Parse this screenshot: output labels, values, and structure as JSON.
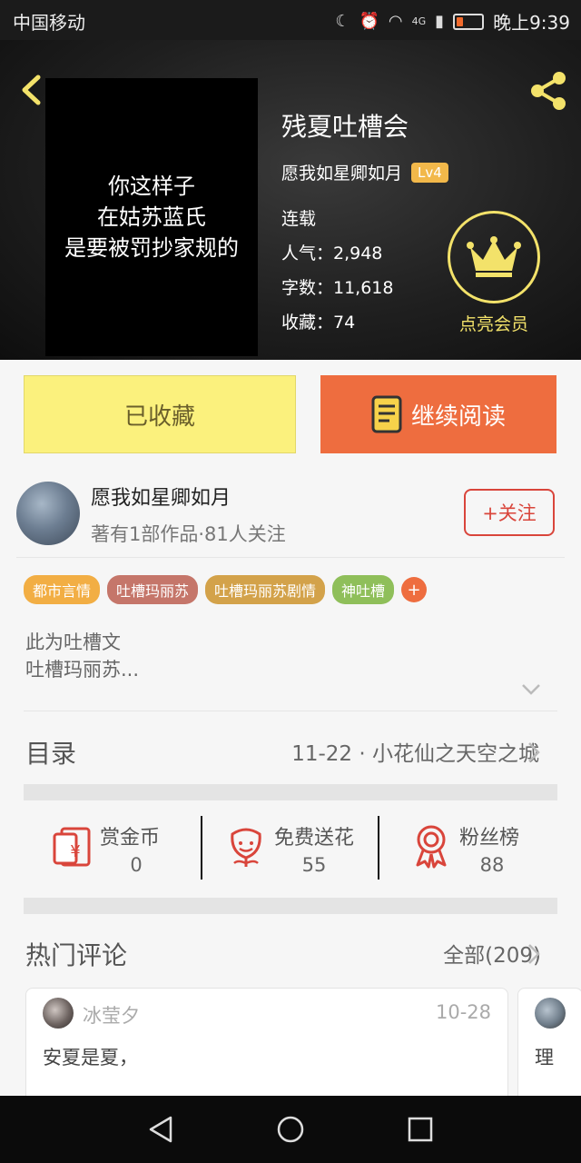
{
  "status_bar": {
    "carrier": "中国移动",
    "network": "4G",
    "time": "晚上9:39"
  },
  "header": {
    "cover_lines": [
      "你这样子",
      "在姑苏蓝氏",
      "是要被罚抄家规的"
    ],
    "title": "残夏吐槽会",
    "author": "愿我如星卿如月",
    "level": "Lv4",
    "status": "连载",
    "popularity": "人气：2,948",
    "word_count": "字数：11,618",
    "favorites": "收藏：74",
    "vip_label": "点亮会员",
    "icons": {
      "back": "chevron-left-icon",
      "share": "share-icon",
      "vip": "crown-icon"
    },
    "accent_color": "#f3e26a"
  },
  "actions": {
    "collected_label": "已收藏",
    "continue_label": "继续阅读"
  },
  "author_card": {
    "name": "愿我如星卿如月",
    "subtitle": "著有1部作品·81人关注",
    "follow_label": "+关注"
  },
  "tags": [
    {
      "label": "都市言情",
      "color": "#f2ae44"
    },
    {
      "label": "吐槽玛丽苏",
      "color": "#c5766a"
    },
    {
      "label": "吐槽玛丽苏剧情",
      "color": "#d3a24a"
    },
    {
      "label": "神吐槽",
      "color": "#8fbf5a"
    }
  ],
  "tag_add_label": "+",
  "description": {
    "line1": "此为吐槽文",
    "line2": "吐槽玛丽苏..."
  },
  "directory": {
    "title": "目录",
    "latest": "11-22 · 小花仙之天空之城"
  },
  "stats": [
    {
      "label": "赏金币",
      "value": "0",
      "icon": "red-envelope-icon"
    },
    {
      "label": "免费送花",
      "value": "55",
      "icon": "flower-icon"
    },
    {
      "label": "粉丝榜",
      "value": "88",
      "icon": "medal-icon"
    }
  ],
  "comments": {
    "title": "热门评论",
    "all_label": "全部(209)",
    "items": [
      {
        "user": "冰莹夕",
        "date": "10-28",
        "text": "安夏是夏，"
      },
      {
        "text": "理"
      }
    ]
  }
}
